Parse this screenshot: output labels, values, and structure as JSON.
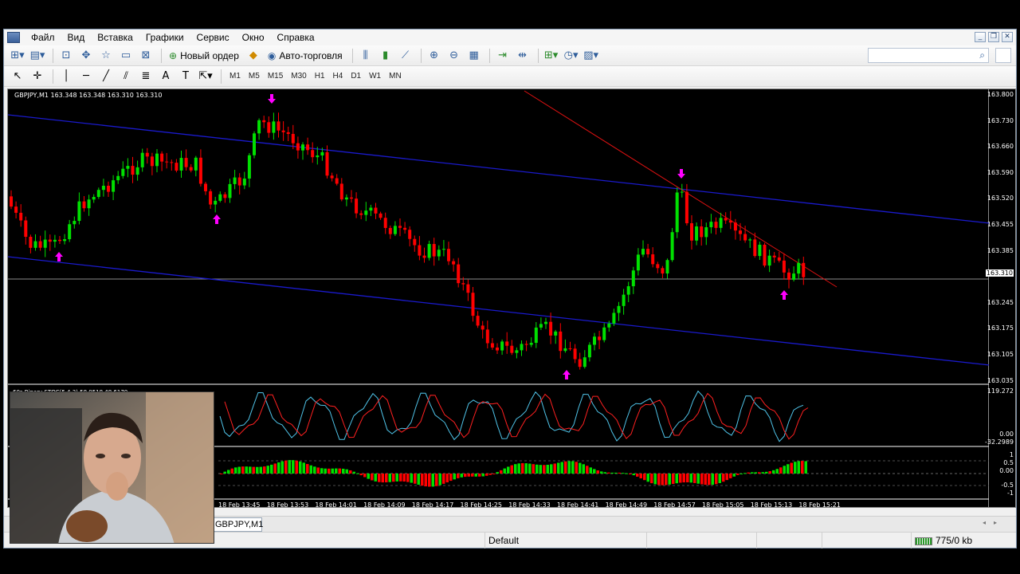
{
  "menu": [
    "Файл",
    "Вид",
    "Вставка",
    "Графики",
    "Сервис",
    "Окно",
    "Справка"
  ],
  "toolbar": {
    "new_order_label": "Новый ордер",
    "auto_trading_label": "Авто-торговля",
    "search_placeholder": ""
  },
  "timeframes": [
    "M1",
    "M5",
    "M15",
    "M30",
    "H1",
    "H4",
    "D1",
    "W1",
    "MN"
  ],
  "chart": {
    "header": "GBPJPY,M1  163.348 163.348 163.310 163.310",
    "indicator1_label": "60s Binary STOC(5,4,3) 58.0518 48.6170",
    "price_labels": [
      "163.800",
      "163.730",
      "163.660",
      "163.590",
      "163.520",
      "163.455",
      "163.385",
      "163.310",
      "163.245",
      "163.175",
      "163.105",
      "163.035"
    ],
    "current_price": "163.310",
    "stoch_scale": [
      "119.272",
      "0.00",
      "-32.2989"
    ],
    "osc_scale": [
      "1",
      "0.5",
      "0.00",
      "-0.5",
      "-1"
    ],
    "time_labels": [
      "18 Feb 13:45",
      "18 Feb 13:53",
      "18 Feb 14:01",
      "18 Feb 14:09",
      "18 Feb 14:17",
      "18 Feb 14:25",
      "18 Feb 14:33",
      "18 Feb 14:41",
      "18 Feb 14:49",
      "18 Feb 14:57",
      "18 Feb 15:05",
      "18 Feb 15:13",
      "18 Feb 15:21"
    ],
    "colors": {
      "bull": "#00e000",
      "bear": "#ff0000",
      "channel": "#1a1acc",
      "trend": "#dd1111",
      "arrow": "#ff00ff"
    }
  },
  "tab": {
    "label": "GBPJPY,M1"
  },
  "status": {
    "profile": "Default",
    "traffic": "775/0 kb"
  }
}
